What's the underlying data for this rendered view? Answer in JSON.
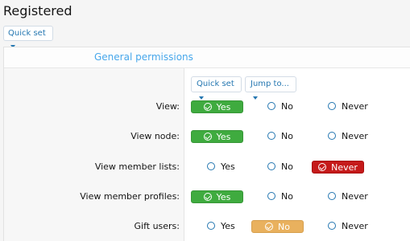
{
  "page": {
    "title": "Registered"
  },
  "toolbar": {
    "quick_set_label": "Quick set"
  },
  "section": {
    "title": "General permissions",
    "quick_set_label": "Quick set",
    "jump_to_label": "Jump to..."
  },
  "options": {
    "yes": "Yes",
    "no": "No",
    "never": "Never"
  },
  "colors": {
    "yes": "#3fab3f",
    "no": "#e9b15e",
    "never": "#c51a1a",
    "accent": "#2577b1",
    "section_title": "#47a7eb"
  },
  "permissions": [
    {
      "label": "View:",
      "selected": "yes"
    },
    {
      "label": "View node:",
      "selected": "yes"
    },
    {
      "label": "View member lists:",
      "selected": "never"
    },
    {
      "label": "View member profiles:",
      "selected": "yes"
    },
    {
      "label": "Gift users:",
      "selected": "no"
    }
  ]
}
